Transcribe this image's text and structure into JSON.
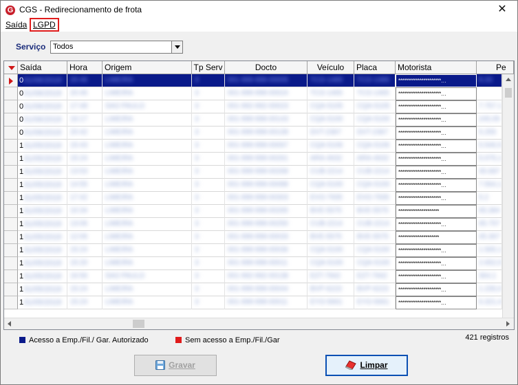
{
  "window": {
    "title": "CGS - Redirecionamento de frota",
    "close_glyph": "✕"
  },
  "menu": {
    "items": [
      {
        "label": "Saída"
      },
      {
        "label": "LGPD"
      }
    ]
  },
  "filter": {
    "label": "Serviço",
    "selected": "Todos"
  },
  "grid": {
    "columns": [
      "Saída",
      "Hora",
      "Origem",
      "Tp Serv",
      "Docto",
      "Veículo",
      "Placa",
      "Motorista",
      "Pe"
    ],
    "rows": [
      {
        "first": "0",
        "blur": [
          "01/06/2019",
          "20:46",
          "LIMEIRA",
          "3",
          "001-999-999-00005",
          "TCO-1489",
          "TCO-1489"
        ],
        "motorista": "**********************…",
        "peso": "8,33"
      },
      {
        "first": "0",
        "blur": [
          "01/06/2019",
          "20:46",
          "LIMEIRA",
          "3",
          "001-999-999-00024",
          "TCO-1465",
          "TCO-1465"
        ],
        "motorista": "**********************…",
        "peso": ""
      },
      {
        "first": "0",
        "blur": [
          "01/06/2019",
          "17:48",
          "SAO PAULO",
          "3",
          "001-992-992-00023",
          "CQA-5105",
          "CQA-5105"
        ],
        "motorista": "**********************…",
        "peso": "7.757.1"
      },
      {
        "first": "0",
        "blur": [
          "01/06/2019",
          "16:17",
          "LIMEIRA",
          "3",
          "001-999-999-00143",
          "CQA-5100",
          "CQA-5100"
        ],
        "motorista": "**********************…",
        "peso": "245,05"
      },
      {
        "first": "0",
        "blur": [
          "01/06/2019",
          "20:42",
          "LIMEIRA",
          "3",
          "001-999-999-00139",
          "DVT-2367",
          "DVT-2367"
        ],
        "motorista": "**********************…",
        "peso": "5.255"
      },
      {
        "first": "1",
        "blur": [
          "31/05/2019",
          "15:43",
          "LIMEIRA",
          "3",
          "001-999-999-00067",
          "CQA-5106",
          "CQA-5106"
        ],
        "motorista": "**********************…",
        "peso": "5.546,5"
      },
      {
        "first": "1",
        "blur": [
          "31/05/2019",
          "15:24",
          "LIMEIRA",
          "3",
          "001-999-999-00261",
          "ARA-4632",
          "ARA-4632"
        ],
        "motorista": "**********************…",
        "peso": "5.075,1"
      },
      {
        "first": "1",
        "blur": [
          "31/05/2019",
          "13:53",
          "LIMEIRA",
          "3",
          "001-999-999-00268",
          "CUB-2214",
          "CUB-2214"
        ],
        "motorista": "**********************…",
        "peso": "45.687"
      },
      {
        "first": "1",
        "blur": [
          "31/05/2019",
          "14:55",
          "LIMEIRA",
          "3",
          "001-999-999-00088",
          "CQA-5100",
          "CQA-5100"
        ],
        "motorista": "**********************…",
        "peso": "7.564,1"
      },
      {
        "first": "1",
        "blur": [
          "31/05/2019",
          "17:42",
          "LIMEIRA",
          "3",
          "001-999-999-00303",
          "EVO-7935",
          "EVO-7935"
        ],
        "motorista": "**********************…",
        "peso": "5.2"
      },
      {
        "first": "1",
        "blur": [
          "31/05/2019",
          "10:34",
          "LIMEIRA",
          "3",
          "001-999-999-00265",
          "BVE-5575",
          "BVE-5575"
        ],
        "motorista": "*********************",
        "peso": "65,384"
      },
      {
        "first": "1",
        "blur": [
          "31/05/2019",
          "13:06",
          "LIMEIRA",
          "3",
          "001-999-999-00250",
          "CUB-2214",
          "CUB-2214"
        ],
        "motorista": "**********************…",
        "peso": "65.757"
      },
      {
        "first": "1",
        "blur": [
          "31/05/2019",
          "12:06",
          "LIMEIRA",
          "3",
          "001-999-999-00033",
          "BVE-5575",
          "BVE-5575"
        ],
        "motorista": "*********************",
        "peso": "45.367"
      },
      {
        "first": "1",
        "blur": [
          "31/05/2019",
          "15:24",
          "LIMEIRA",
          "3",
          "001-999-999-00036",
          "CQA-5100",
          "CQA-5100"
        ],
        "motorista": "**********************…",
        "peso": "1.565,1"
      },
      {
        "first": "1",
        "blur": [
          "31/05/2019",
          "15:20",
          "LIMEIRA",
          "3",
          "001-999-999-00011",
          "CQA-5100",
          "CQA-5100"
        ],
        "motorista": "**********************…",
        "peso": "2.652,0"
      },
      {
        "first": "1",
        "blur": [
          "31/05/2019",
          "16:56",
          "SAO PAULO",
          "3",
          "001-992-992-00138",
          "EZT-7942",
          "EZT-7942"
        ],
        "motorista": "**********************…",
        "peso": "364,1"
      },
      {
        "first": "1",
        "blur": [
          "31/05/2019",
          "15:24",
          "LIMEIRA",
          "3",
          "001-999-999-00044",
          "BVP-6223",
          "BVP-6223"
        ],
        "motorista": "**********************…",
        "peso": "1.235,0"
      },
      {
        "first": "1",
        "blur": [
          "31/05/2019",
          "15:24",
          "LIMEIRA",
          "3",
          "001-999-999-00011",
          "EYO-5661",
          "EYO-5661"
        ],
        "motorista": "**********************…",
        "peso": "6.321,4"
      }
    ]
  },
  "legend": {
    "authorized": {
      "label": "Acesso a Emp./Fil./ Gar. Autorizado",
      "color": "#0a1a8a"
    },
    "unauthorized": {
      "label": "Sem acesso a Emp./Fil./Gar",
      "color": "#e01b1b"
    }
  },
  "status": {
    "count": "421 registros"
  },
  "buttons": {
    "save": {
      "label": "Gravar",
      "icon": "floppy-disk-icon"
    },
    "clear": {
      "label": "Limpar",
      "icon": "eraser-icon"
    }
  }
}
